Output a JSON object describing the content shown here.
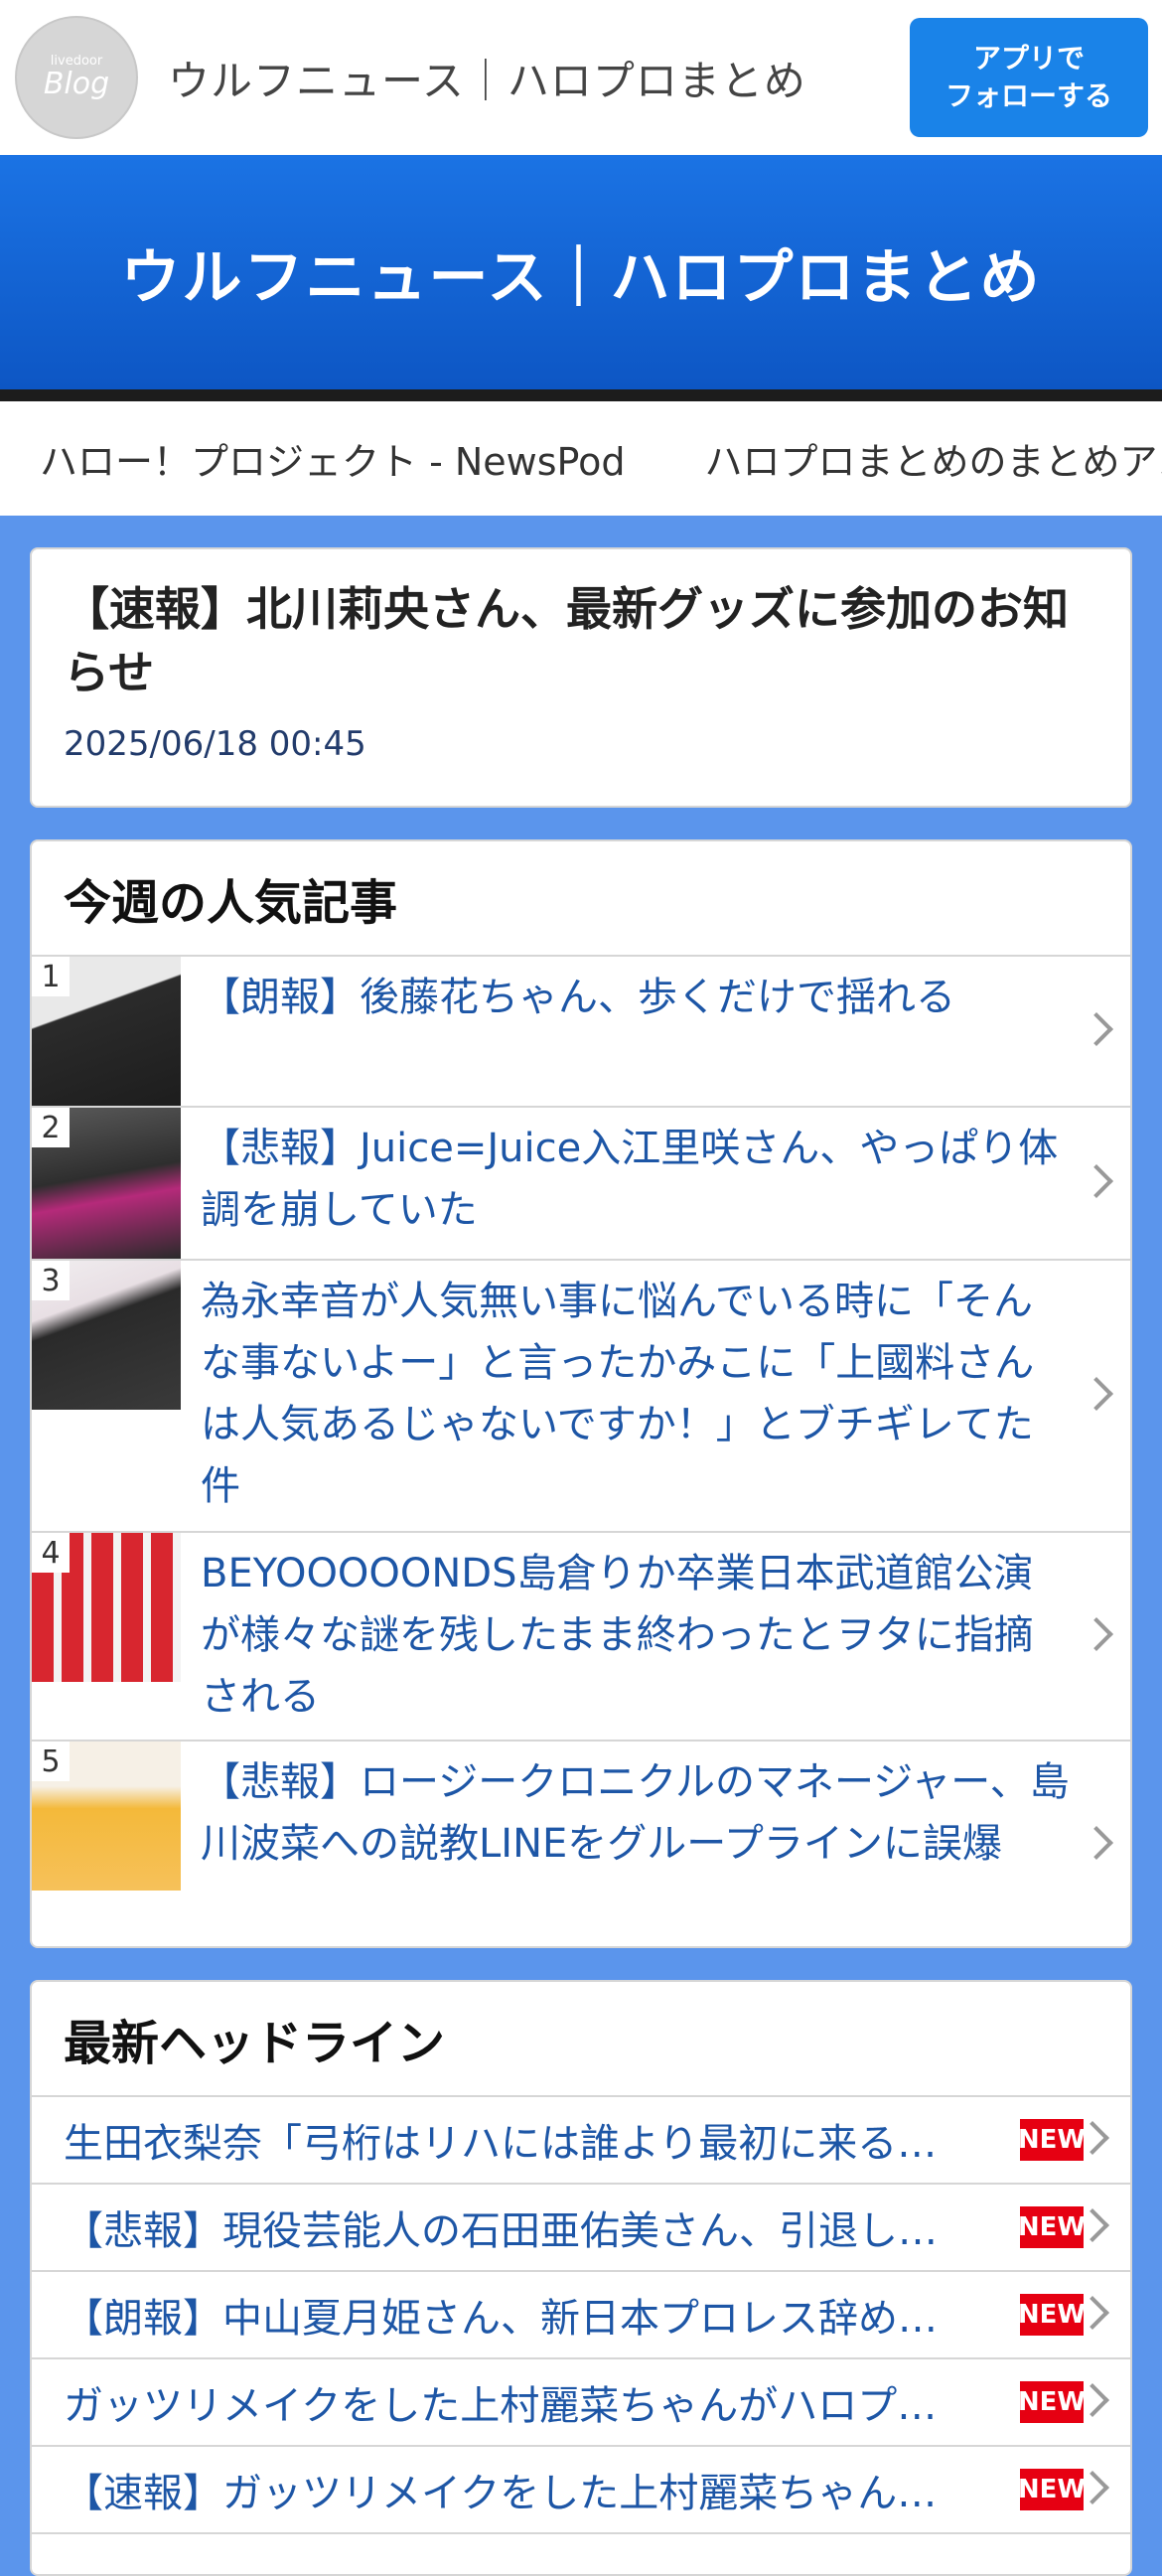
{
  "header": {
    "logo_small": "livedoor",
    "logo_big": "Blog",
    "site_name": "ウルフニュース｜ハロプロまとめ",
    "follow_line1": "アプリで",
    "follow_line2": "フォローする"
  },
  "banner": {
    "title": "ウルフニュース｜ハロプロまとめ"
  },
  "links": [
    "ハロー！プロジェクト - NewsPod",
    "ハロプロまとめのまとめアンテナ"
  ],
  "article": {
    "title": "【速報】北川莉央さん、最新グッズに参加のお知らせ",
    "date": "2025/06/18 00:45"
  },
  "popular": {
    "heading": "今週の人気記事",
    "items": [
      {
        "rank": "1",
        "title": "【朗報】後藤花ちゃん、歩くだけで揺れる",
        "thumb_color": "#2b2b2b"
      },
      {
        "rank": "2",
        "title": "【悲報】Juice=Juice入江里咲さん、やっぱり体調を崩していた",
        "thumb_color": "#7a2a56"
      },
      {
        "rank": "3",
        "title": "為永幸音が人気無い事に悩んでいる時に「そんな事ないよー」と言ったかみこに「上國料さんは人気あるじゃないですか！」とブチギレてた件",
        "thumb_color": "#3a3a3a"
      },
      {
        "rank": "4",
        "title": "BEYOOOOONDS島倉りか卒業日本武道館公演が様々な謎を残したまま終わったとヲタに指摘される",
        "thumb_color": "#c8202a"
      },
      {
        "rank": "5",
        "title": "【悲報】ロージークロニクルのマネージャー、島川波菜への説教LINEをグループラインに誤爆",
        "thumb_color": "#f2b233"
      }
    ]
  },
  "headlines": {
    "heading": "最新ヘッドライン",
    "badge": "NEW",
    "items": [
      "生田衣梨奈「弓桁はリハには誰より最初に来る…",
      "【悲報】現役芸能人の石田亜佑美さん、引退し…",
      "【朗報】中山夏月姫さん、新日本プロレス辞め…",
      "ガッツリメイクをした上村麗菜ちゃんがハロプ…",
      "【速報】ガッツリメイクをした上村麗菜ちゃん…"
    ]
  }
}
